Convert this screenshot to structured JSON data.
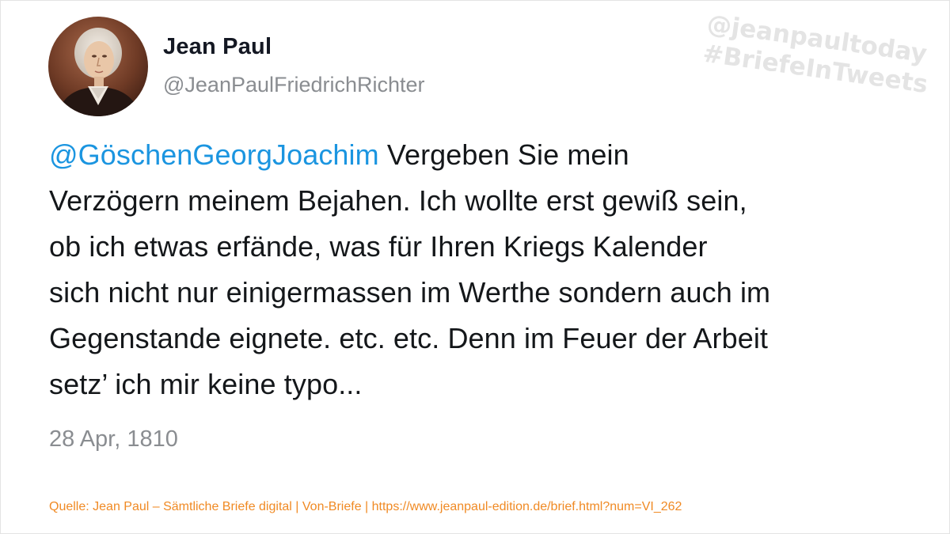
{
  "author": {
    "display_name": "Jean Paul",
    "handle": "@JeanPaulFriedrichRichter",
    "avatar": "portrait-avatar"
  },
  "watermark": {
    "line1": "@jeanpaultoday",
    "line2": "#BriefeInTweets"
  },
  "tweet": {
    "mention": "@GöschenGeorgJoachim",
    "lines": [
      " Vergeben Sie mein",
      "Verzögern meinem Bejahen. Ich wollte erst gewiß sein,",
      "ob ich etwas erfände, was für Ihren Kriegs Kalender",
      "sich nicht nur einigermassen im Werthe sondern auch im",
      "Gegenstande eignete. etc. etc. Denn im Feuer der Arbeit",
      "setz’ ich mir keine typo..."
    ],
    "date": "28 Apr, 1810"
  },
  "source": "Quelle: Jean Paul – Sämtliche Briefe digital | Von-Briefe | https://www.jeanpaul-edition.de/brief.html?num=VI_262",
  "colors": {
    "mention": "#1b95e0",
    "text": "#14171a",
    "muted": "#8a8d91",
    "source": "#f08a24",
    "watermark": "#e4e4e4"
  }
}
